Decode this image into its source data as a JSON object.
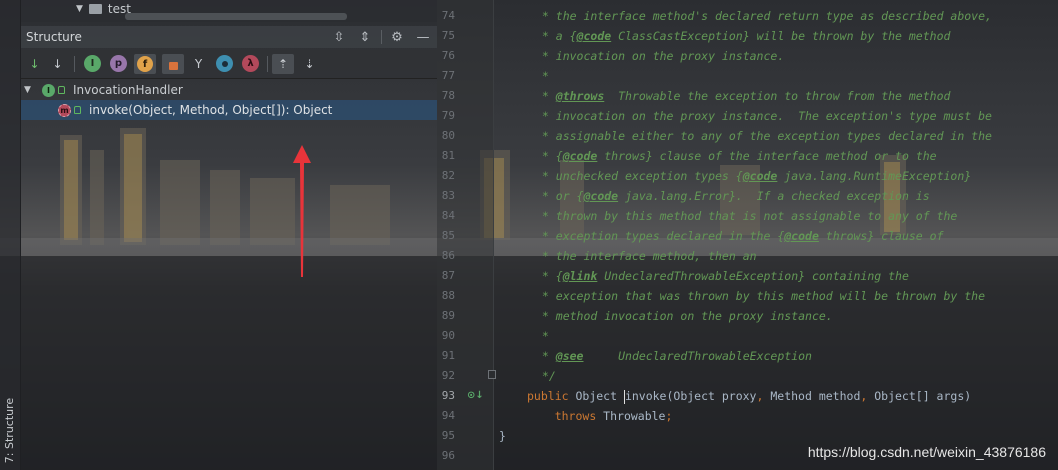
{
  "project_tree": {
    "folder_label": "test"
  },
  "structure": {
    "title": "Structure",
    "tool_stripe_label": "7: Structure",
    "toolbar": [
      {
        "name": "sort-visibility-icon",
        "glyph": "↕"
      },
      {
        "name": "sort-alpha-icon",
        "glyph": "↓"
      },
      {
        "name": "show-inherited-icon",
        "glyph": "I"
      },
      {
        "name": "show-properties-icon",
        "glyph": "p"
      },
      {
        "name": "show-fields-icon",
        "glyph": "f"
      },
      {
        "name": "show-non-public-icon",
        "glyph": "🔒"
      },
      {
        "name": "show-lambdas-tree-icon",
        "glyph": "Y"
      },
      {
        "name": "show-anonymous-icon",
        "glyph": "●"
      },
      {
        "name": "show-lambda-icon",
        "glyph": "λ"
      },
      {
        "name": "autoscroll-to-source-icon",
        "glyph": "⇡"
      },
      {
        "name": "autoscroll-from-source-icon",
        "glyph": "⇣"
      }
    ],
    "tree": {
      "root_label": "InvocationHandler",
      "method_label": "invoke(Object, Method, Object[]): Object"
    }
  },
  "editor": {
    "lines": [
      {
        "n": "74",
        "text": " * the interface method's declared return type as described above,"
      },
      {
        "n": "75",
        "text": " * a {@code ClassCastException} will be thrown by the method"
      },
      {
        "n": "76",
        "text": " * invocation on the proxy instance."
      },
      {
        "n": "77",
        "text": " *"
      },
      {
        "n": "78",
        "text": " * @throws  Throwable the exception to throw from the method"
      },
      {
        "n": "79",
        "text": " * invocation on the proxy instance.  The exception's type must be"
      },
      {
        "n": "80",
        "text": " * assignable either to any of the exception types declared in the"
      },
      {
        "n": "81",
        "text": " * {@code throws} clause of the interface method or to the"
      },
      {
        "n": "82",
        "text": " * unchecked exception types {@code java.lang.RuntimeException}"
      },
      {
        "n": "83",
        "text": " * or {@code java.lang.Error}.  If a checked exception is"
      },
      {
        "n": "84",
        "text": " * thrown by this method that is not assignable to any of the"
      },
      {
        "n": "85",
        "text": " * exception types declared in the {@code throws} clause of"
      },
      {
        "n": "86",
        "text": " * the interface method, then an"
      },
      {
        "n": "87",
        "text": " * {@link UndeclaredThrowableException} containing the"
      },
      {
        "n": "88",
        "text": " * exception that was thrown by this method will be thrown by the"
      },
      {
        "n": "89",
        "text": " * method invocation on the proxy instance."
      },
      {
        "n": "90",
        "text": " *"
      },
      {
        "n": "91",
        "text": " * @see     UndeclaredThrowableException"
      },
      {
        "n": "92",
        "text": " */"
      },
      {
        "n": "93",
        "text": "public Object invoke(Object proxy, Method method, Object[] args)"
      },
      {
        "n": "94",
        "text": "    throws Throwable;"
      },
      {
        "n": "95",
        "text": "}"
      },
      {
        "n": "96",
        "text": ""
      }
    ],
    "current_line": "93"
  },
  "watermark": "https://blog.csdn.net/weixin_43876186",
  "colors": {
    "comment": "#629755",
    "keyword": "#cc7832",
    "selection": "#2e4a66",
    "arrow": "#e8343a"
  }
}
